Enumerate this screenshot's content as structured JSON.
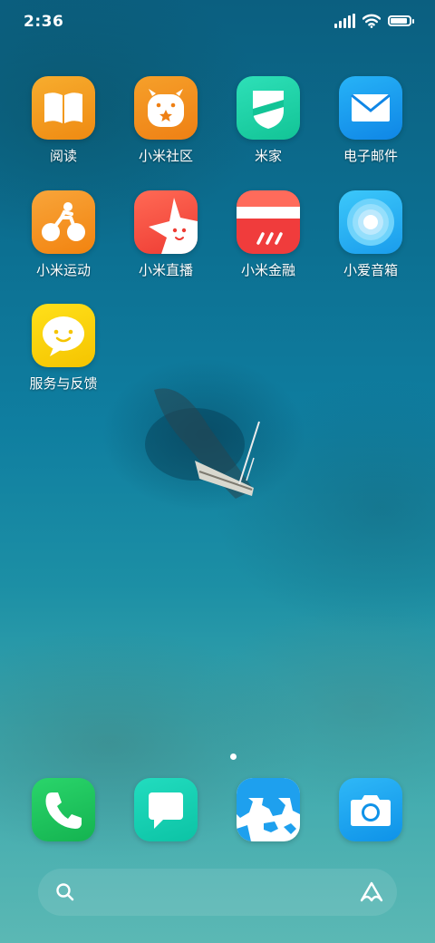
{
  "status_bar": {
    "time": "2:36",
    "battery_level": 1.0
  },
  "apps": [
    {
      "label": "阅读",
      "icon": "book-icon"
    },
    {
      "label": "小米社区",
      "icon": "mi-community-icon"
    },
    {
      "label": "米家",
      "icon": "mijia-icon"
    },
    {
      "label": "电子邮件",
      "icon": "mail-icon"
    },
    {
      "label": "小米运动",
      "icon": "bicycle-icon"
    },
    {
      "label": "小米直播",
      "icon": "live-star-icon"
    },
    {
      "label": "小米金融",
      "icon": "finance-card-icon"
    },
    {
      "label": "小爱音箱",
      "icon": "speaker-rings-icon"
    },
    {
      "label": "服务与反馈",
      "icon": "smiley-chat-icon"
    }
  ],
  "dock": [
    {
      "icon": "phone-icon"
    },
    {
      "icon": "message-icon"
    },
    {
      "icon": "globe-map-icon"
    },
    {
      "icon": "camera-icon"
    }
  ],
  "pager": {
    "current_page": 1,
    "total_pages": 1
  },
  "search_bar": {
    "left_icon": "search-icon",
    "right_icon": "assistant-icon"
  },
  "colors": {
    "reading": "#f39a1e",
    "community": "#f08a1c",
    "mijia": "#1fd1a6",
    "mail": "#1c9cf0",
    "sport": "#f7931e",
    "live": "#f24b3f",
    "finance": "#f03c3c",
    "speaker": "#2ab6f5",
    "feedback": "#f7d000",
    "phone": "#1ec45e",
    "message": "#13d0b3",
    "camera": "#1aa8f0"
  }
}
